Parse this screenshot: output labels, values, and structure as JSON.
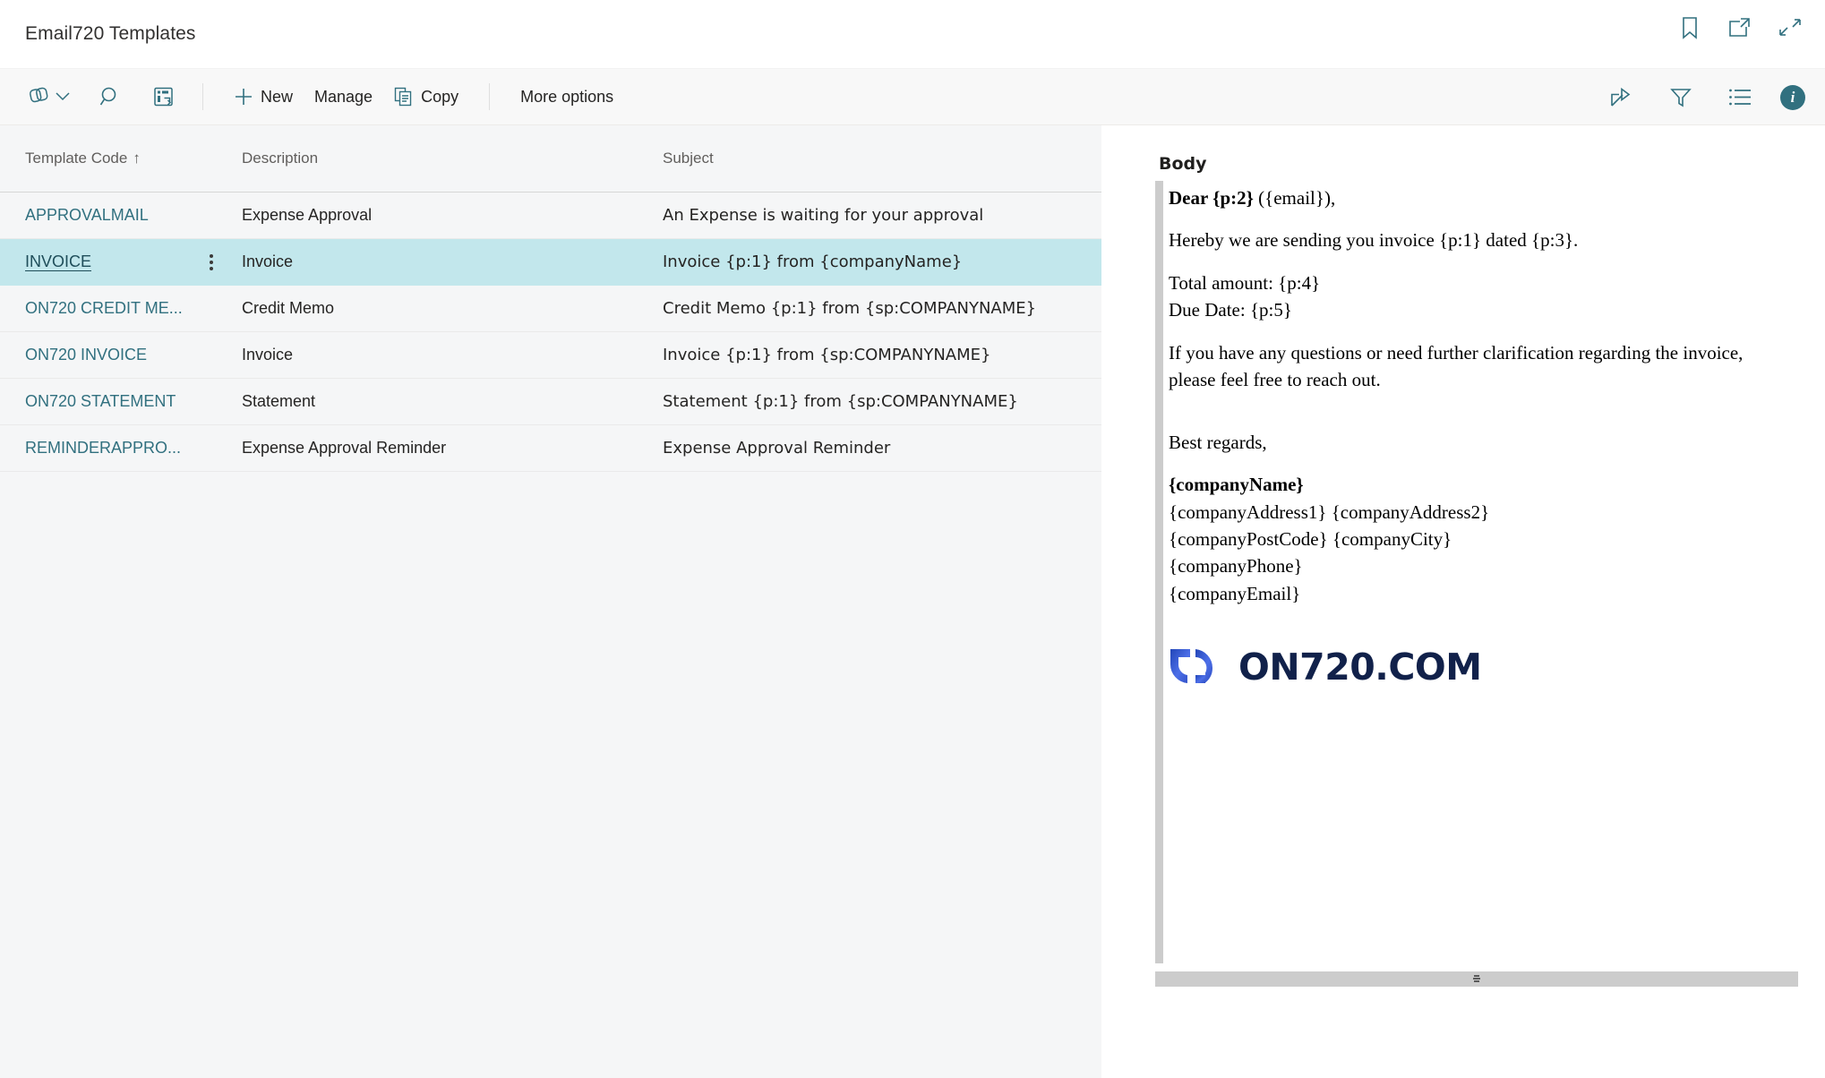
{
  "window": {
    "title": "Email720 Templates",
    "actions": [
      {
        "name": "bookmark-icon",
        "label": "Bookmark"
      },
      {
        "name": "open-in-new-window-icon",
        "label": "Open in new window"
      },
      {
        "name": "collapse-icon",
        "label": "Collapse"
      }
    ]
  },
  "commandbar": {
    "left_icons": [
      {
        "name": "share-teams-icon",
        "label": "Share"
      },
      {
        "name": "search-icon",
        "label": "Search"
      },
      {
        "name": "refresh-page-icon",
        "label": "Refresh"
      }
    ],
    "buttons": [
      {
        "name": "new-button",
        "label": "New",
        "icon": "plus-icon"
      },
      {
        "name": "manage-button",
        "label": "Manage",
        "icon": ""
      },
      {
        "name": "copy-button",
        "label": "Copy",
        "icon": "copy-icon"
      }
    ],
    "more_options_label": "More options",
    "right_icons": [
      {
        "name": "share-icon",
        "label": "Share"
      },
      {
        "name": "filter-icon",
        "label": "Filter"
      },
      {
        "name": "list-view-icon",
        "label": "Show as list"
      },
      {
        "name": "info-icon",
        "label": "i"
      }
    ]
  },
  "grid": {
    "columns": [
      {
        "key": "code",
        "label": "Template Code",
        "sort": "↑"
      },
      {
        "key": "description",
        "label": "Description",
        "sort": ""
      },
      {
        "key": "subject",
        "label": "Subject",
        "sort": ""
      }
    ],
    "rows": [
      {
        "code": "APPROVALMAIL",
        "description": "Expense Approval",
        "subject": "An Expense is waiting for your approval",
        "selected": false
      },
      {
        "code": "INVOICE",
        "description": "Invoice",
        "subject": "Invoice {p:1} from {companyName}",
        "selected": true
      },
      {
        "code": "ON720 CREDIT ME...",
        "description": "Credit Memo",
        "subject": "Credit Memo {p:1} from {sp:COMPANYNAME}",
        "selected": false
      },
      {
        "code": "ON720 INVOICE",
        "description": "Invoice",
        "subject": "Invoice {p:1} from {sp:COMPANYNAME}",
        "selected": false
      },
      {
        "code": "ON720 STATEMENT",
        "description": "Statement",
        "subject": "Statement {p:1} from {sp:COMPANYNAME}",
        "selected": false
      },
      {
        "code": "REMINDERAPPRO...",
        "description": "Expense Approval Reminder",
        "subject": "Expense Approval Reminder",
        "selected": false
      }
    ]
  },
  "body_pane": {
    "label": "Body",
    "greeting_bold": "Dear {p:2}",
    "greeting_rest": " ({email}),",
    "line_hereby": "Hereby we are sending you invoice {p:1} dated {p:3}.",
    "line_total": "Total amount: {p:4}",
    "line_due": "Due Date: {p:5}",
    "line_questions": "If you have any questions or need further clarification regarding the invoice, please feel free to reach out.",
    "line_regards": "Best regards,",
    "company_name": "{companyName}",
    "company_address": "{companyAddress1}  {companyAddress2}",
    "company_city": "{companyPostCode}  {companyCity}",
    "company_phone": "{companyPhone}",
    "company_email": "{companyEmail}",
    "logo_text": "ON720.COM"
  },
  "colors": {
    "accent": "#31707f",
    "selection": "#c2e7ec",
    "list_background": "#f5f6f7",
    "logo_blue_dark": "#2246b8",
    "logo_blue_light": "#5b82f0",
    "logo_word": "#11214a"
  }
}
